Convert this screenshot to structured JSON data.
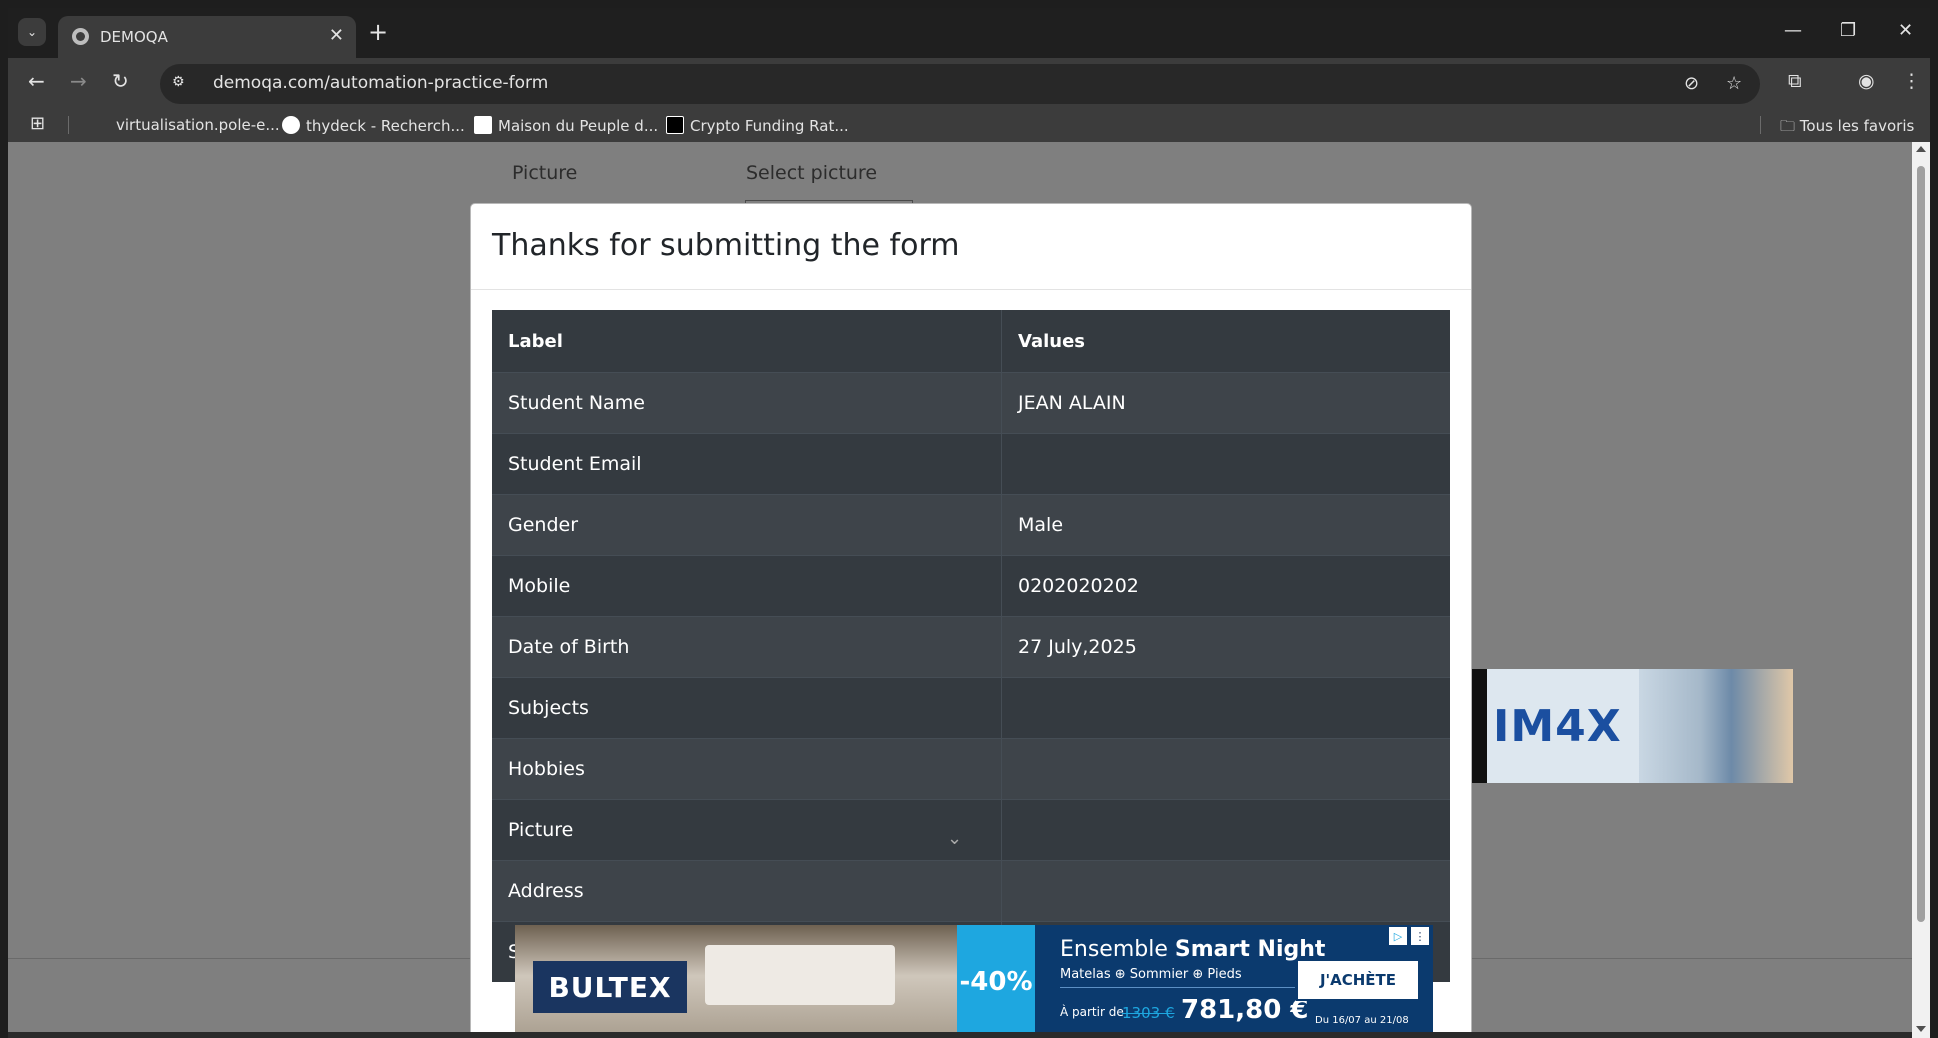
{
  "browser": {
    "tab_title": "DEMOQA",
    "url": "demoqa.com/automation-practice-form",
    "bookmarks": [
      {
        "label": "virtualisation.pole-e..."
      },
      {
        "label": "thydeck - Recherch..."
      },
      {
        "label": "Maison du Peuple d..."
      },
      {
        "label": "Crypto Funding Rat..."
      }
    ],
    "all_bookmarks_label": "Tous les favoris"
  },
  "form_background": {
    "picture_label": "Picture",
    "select_picture_label": "Select picture"
  },
  "modal": {
    "title": "Thanks for submitting the form",
    "table": {
      "headers": [
        "Label",
        "Values"
      ],
      "rows": [
        [
          "Student Name",
          "JEAN ALAIN"
        ],
        [
          "Student Email",
          ""
        ],
        [
          "Gender",
          "Male"
        ],
        [
          "Mobile",
          "0202020202"
        ],
        [
          "Date of Birth",
          "27 July,2025"
        ],
        [
          "Subjects",
          ""
        ],
        [
          "Hobbies",
          ""
        ],
        [
          "Picture",
          ""
        ],
        [
          "Address",
          ""
        ],
        [
          "S",
          ""
        ]
      ]
    }
  },
  "side_ad": {
    "logo": "IM4X"
  },
  "bottom_ad": {
    "brand": "BULTEX",
    "promo": "-40%",
    "title_prefix": "Ensemble ",
    "title_bold": "Smart Night",
    "subtitle": "Matelas ⊕ Sommier ⊕ Pieds",
    "from_label": "À partir de",
    "old_price": "1303 €",
    "price": "781,80 €",
    "cta": "J'ACHÈTE",
    "dates": "Du 16/07 au 21/08"
  }
}
